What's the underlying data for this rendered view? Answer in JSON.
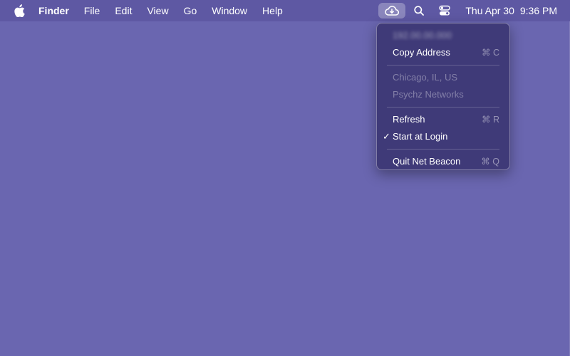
{
  "menubar": {
    "apple_icon": "apple-logo-icon",
    "app_name": "Finder",
    "menus": [
      "File",
      "Edit",
      "View",
      "Go",
      "Window",
      "Help"
    ],
    "status_icons": {
      "netbeacon": "cloud-icon",
      "search": "search-icon",
      "control_center": "control-center-icon"
    },
    "clock": {
      "date": "Thu Apr 30",
      "time": "9:36 PM"
    }
  },
  "dropdown": {
    "ip_address": "192.00.00.000",
    "copy_address": {
      "label": "Copy Address",
      "shortcut": "⌘ C"
    },
    "location": "Chicago, IL, US",
    "provider": "Psychz Networks",
    "refresh": {
      "label": "Refresh",
      "shortcut": "⌘ R"
    },
    "start_at_login": {
      "label": "Start at Login",
      "checked": true,
      "check_mark": "✓"
    },
    "quit": {
      "label": "Quit Net Beacon",
      "shortcut": "⌘ Q"
    }
  },
  "colors": {
    "desktop": "#6a66b0",
    "menubar": "#5e58a3",
    "menu_background": "#3f3a78"
  }
}
